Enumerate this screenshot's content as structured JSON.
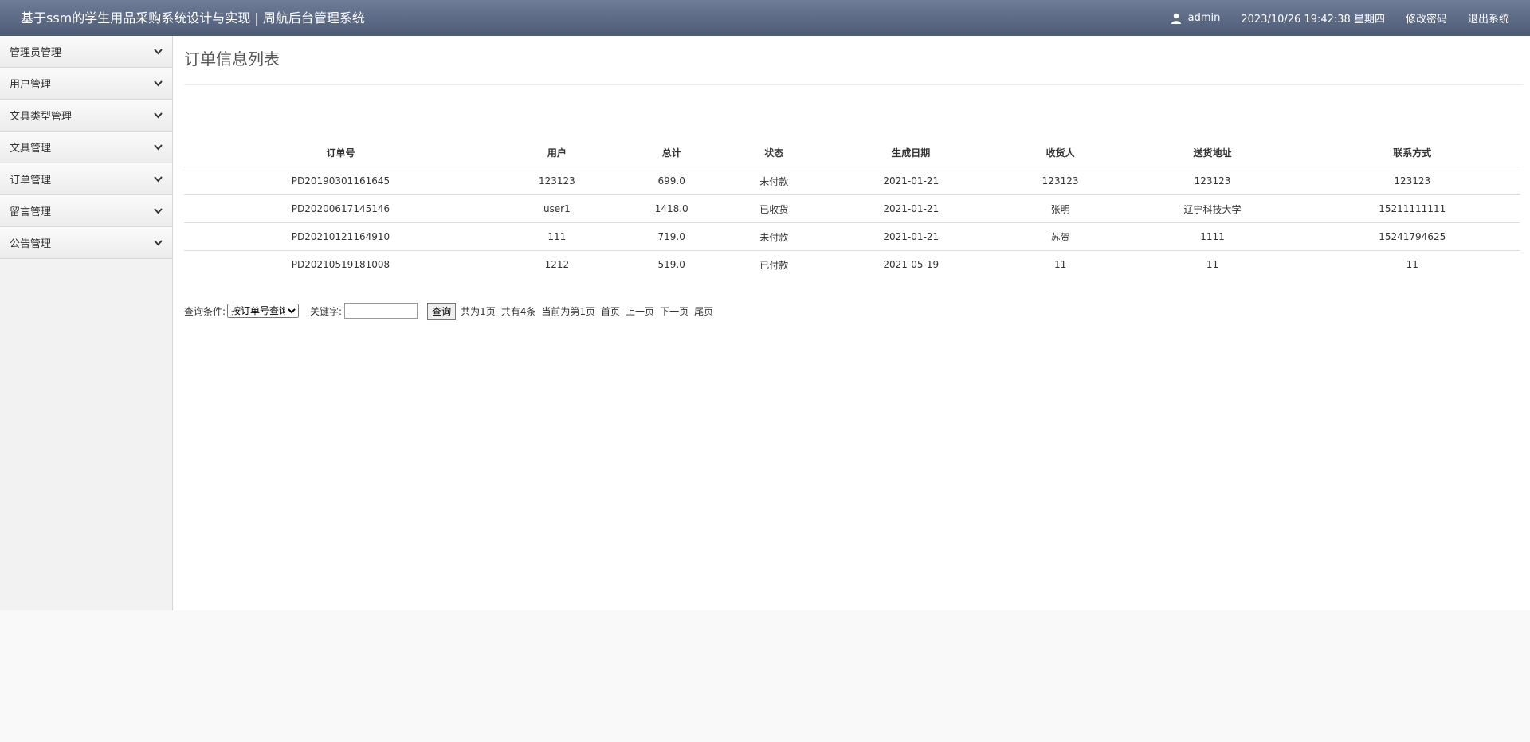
{
  "header": {
    "title": "基于ssm的学生用品采购系统设计与实现 | 周航后台管理系统",
    "username": "admin",
    "datetime": "2023/10/26 19:42:38 星期四",
    "change_password": "修改密码",
    "logout": "退出系统"
  },
  "sidebar": {
    "items": [
      {
        "label": "管理员管理"
      },
      {
        "label": "用户管理"
      },
      {
        "label": "文具类型管理"
      },
      {
        "label": "文具管理"
      },
      {
        "label": "订单管理"
      },
      {
        "label": "留言管理"
      },
      {
        "label": "公告管理"
      }
    ]
  },
  "main": {
    "title": "订单信息列表",
    "columns": [
      "订单号",
      "用户",
      "总计",
      "状态",
      "生成日期",
      "收货人",
      "送货地址",
      "联系方式"
    ],
    "rows": [
      [
        "PD20190301161645",
        "123123",
        "699.0",
        "未付款",
        "2021-01-21",
        "123123",
        "123123",
        "123123"
      ],
      [
        "PD20200617145146",
        "user1",
        "1418.0",
        "已收货",
        "2021-01-21",
        "张明",
        "辽宁科技大学",
        "15211111111"
      ],
      [
        "PD20210121164910",
        "111",
        "719.0",
        "未付款",
        "2021-01-21",
        "苏贺",
        "1111",
        "15241794625"
      ],
      [
        "PD20210519181008",
        "1212",
        "519.0",
        "已付款",
        "2021-05-19",
        "11",
        "11",
        "11"
      ]
    ]
  },
  "search": {
    "condition_label": "查询条件:",
    "condition_selected": "按订单号查询",
    "keyword_label": "关键字:",
    "keyword_value": "",
    "query_button": "查询",
    "total_pages": "共为1页",
    "total_records": "共有4条",
    "current_page": "当前为第1页",
    "first": "首页",
    "prev": "上一页",
    "next": "下一页",
    "last": "尾页"
  }
}
